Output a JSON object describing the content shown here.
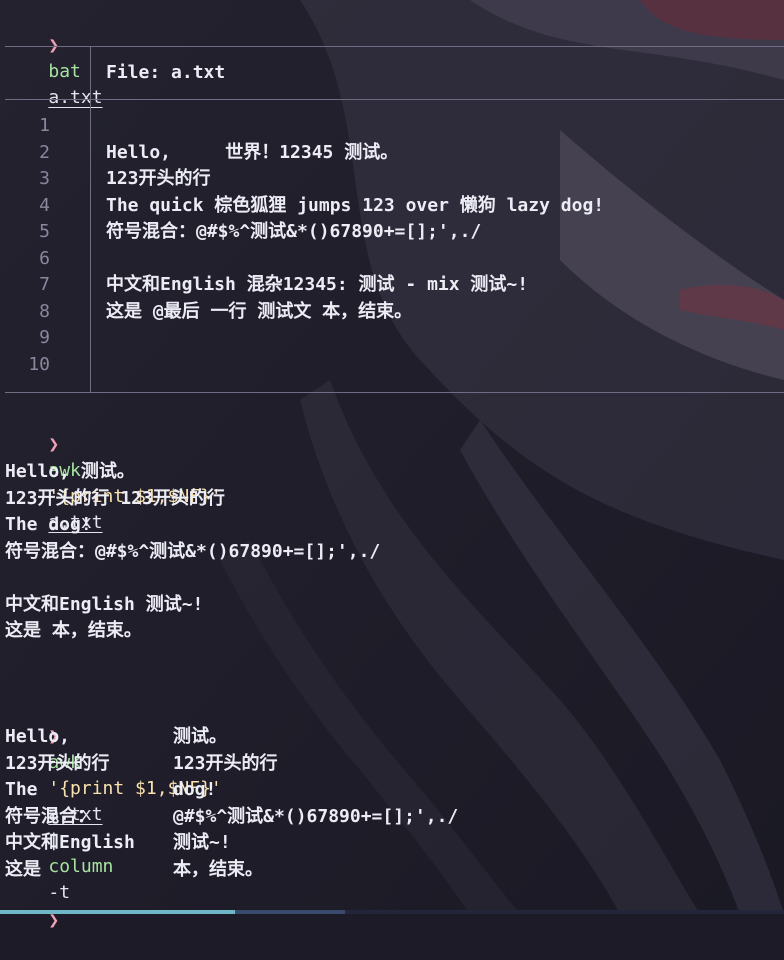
{
  "terminal": {
    "prompt_glyph": "❯",
    "cmd1": {
      "program": "bat",
      "arg": "a.txt"
    },
    "bat": {
      "header_label": "File: ",
      "header_file": "a.txt",
      "line_numbers": [
        "1",
        "2",
        "3",
        "4",
        "5",
        "6",
        "7",
        "8",
        "9",
        "10"
      ],
      "lines": [
        "",
        "Hello,     世界！12345 测试。",
        "123开头的行",
        "The quick 棕色狐狸 jumps 123 over 懒狗 lazy dog!",
        "符号混合：@#$%^测试&*()67890+=[];',./",
        "",
        "中文和English 混杂12345: 测试 - mix 测试~!",
        "这是 @最后 一行 测试文 本，结束。",
        "",
        ""
      ]
    },
    "cmd2": {
      "program": "awk",
      "script": "'{print $1,$NF}'",
      "arg": "a.txt"
    },
    "awk_output": [
      "Hello, 测试。",
      "123开头的行 123开头的行",
      "The dog!",
      "符号混合：@#$%^测试&*()67890+=[];',./",
      "",
      "中文和English 测试~!",
      "这是 本，结束。"
    ],
    "cmd3": {
      "program": "awk",
      "script": "'{print $1,$NF}'",
      "arg": "a.txt",
      "pipe": "|",
      "program2": "column",
      "option": "-t"
    },
    "column_output": [
      {
        "c1": "Hello,",
        "c2": "测试。"
      },
      {
        "c1": "123开头的行",
        "c2": "123开头的行"
      },
      {
        "c1": "The",
        "c2": "dog!"
      },
      {
        "c1": "符号混合：",
        "c2": "@#$%^测试&*()67890+=[];',./"
      },
      {
        "c1": "中文和English",
        "c2": "测试~!"
      },
      {
        "c1": "这是",
        "c2": "本，结束。"
      }
    ],
    "colors": {
      "background": "#1c1b27",
      "prompt": "#f1a1b6",
      "command": "#a6e3a1",
      "string": "#f9e2af",
      "text": "#e4e4ee",
      "line_number": "#8a879e"
    }
  }
}
